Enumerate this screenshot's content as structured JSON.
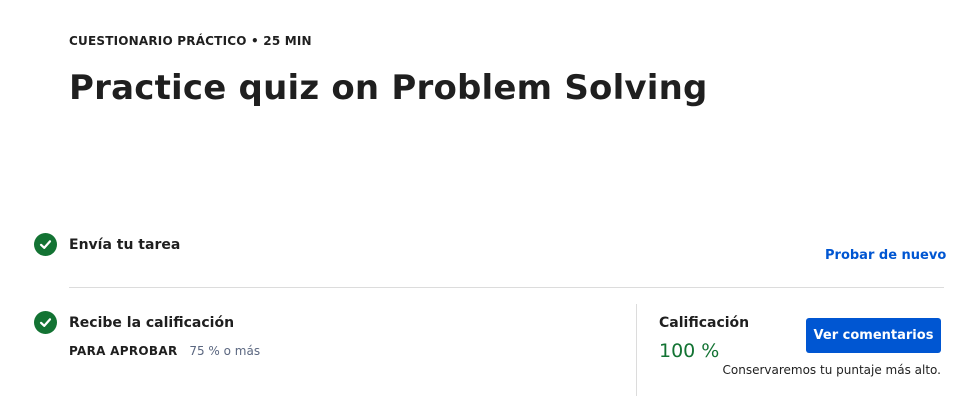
{
  "header": {
    "eyebrow": "CUESTIONARIO PRÁCTICO • 25 MIN",
    "title": "Practice quiz on Problem Solving"
  },
  "steps": [
    {
      "label": "Envía tu tarea",
      "icon": "check-circle-icon",
      "status": "complete",
      "action_label": "Probar de nuevo"
    },
    {
      "label": "Recibe la calificación",
      "icon": "check-circle-icon",
      "status": "complete",
      "pass_label": "PARA APROBAR",
      "pass_value": "75 % o más"
    }
  ],
  "grade": {
    "label": "Calificación",
    "value": "100 %",
    "button_label": "Ver comentarios",
    "note": "Conservaremos tu puntaje más alto."
  },
  "colors": {
    "success_green": "#137333",
    "brand_blue": "#0056d2",
    "text": "#1f1f1f",
    "divider": "#dcdcdc"
  }
}
